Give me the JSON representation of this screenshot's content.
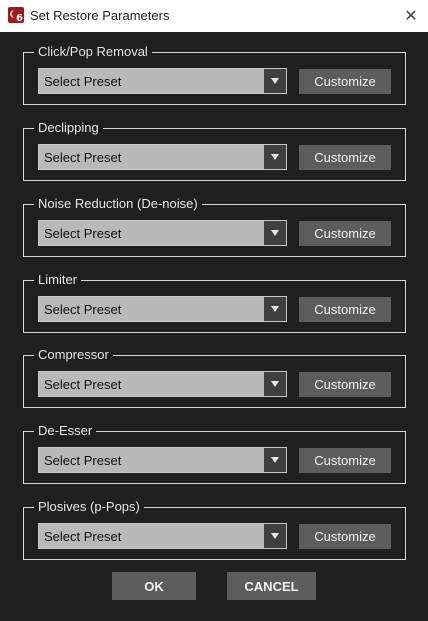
{
  "window": {
    "title": "Set Restore Parameters",
    "app_icon": "app-logo-icon",
    "app_icon_number": "6",
    "close_glyph": "✕"
  },
  "groups": [
    {
      "label": "Click/Pop Removal",
      "select_value": "Select Preset",
      "button_label": "Customize"
    },
    {
      "label": "Declipping",
      "select_value": "Select Preset",
      "button_label": "Customize"
    },
    {
      "label": "Noise Reduction (De-noise)",
      "select_value": "Select Preset",
      "button_label": "Customize"
    },
    {
      "label": "Limiter",
      "select_value": "Select Preset",
      "button_label": "Customize"
    },
    {
      "label": "Compressor",
      "select_value": "Select Preset",
      "button_label": "Customize"
    },
    {
      "label": "De-Esser",
      "select_value": "Select Preset",
      "button_label": "Customize"
    },
    {
      "label": "Plosives (p-Pops)",
      "select_value": "Select Preset",
      "button_label": "Customize"
    }
  ],
  "footer": {
    "ok_label": "OK",
    "cancel_label": "CANCEL"
  },
  "colors": {
    "background": "#1f1f1f",
    "titlebar": "#ffffff",
    "select_bg": "#b9b9b9",
    "button_bg": "#5c5c5c",
    "app_icon": "#9e1b1b"
  }
}
